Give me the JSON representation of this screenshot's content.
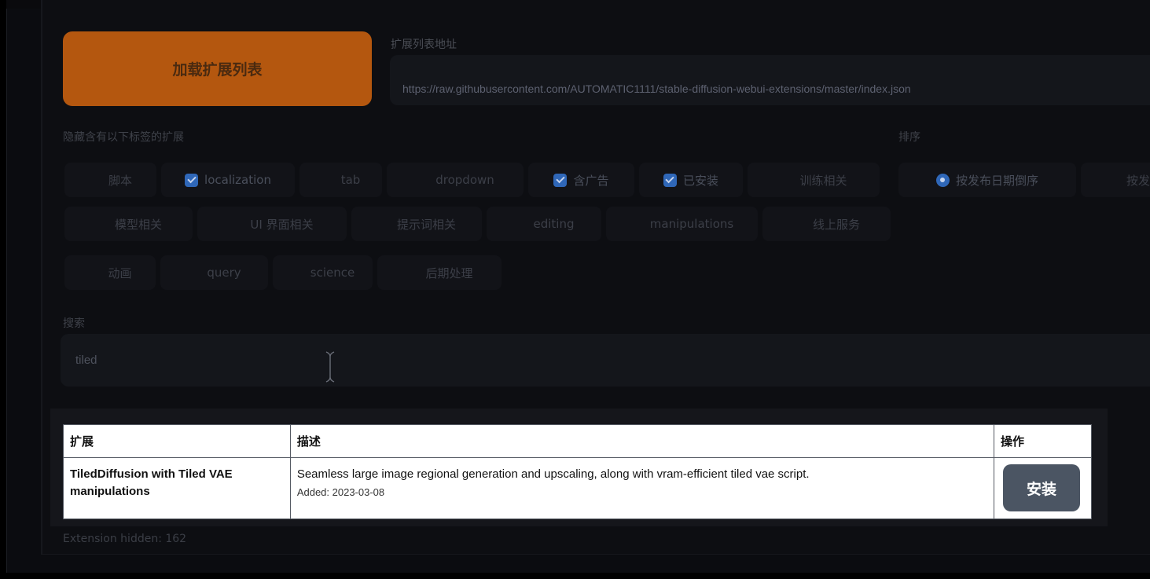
{
  "load_button": {
    "label": "加载扩展列表"
  },
  "url_field": {
    "label": "扩展列表地址",
    "value": "https://raw.githubusercontent.com/AUTOMATIC1111/stable-diffusion-webui-extensions/master/index.json"
  },
  "hide_tags": {
    "label": "隐藏含有以下标签的扩展",
    "rows": [
      [
        {
          "label": "脚本",
          "checked": false
        },
        {
          "label": "localization",
          "checked": true
        },
        {
          "label": "tab",
          "checked": false
        },
        {
          "label": "dropdown",
          "checked": false
        },
        {
          "label": "含广告",
          "checked": true
        },
        {
          "label": "已安装",
          "checked": true
        },
        {
          "label": "训练相关",
          "checked": false
        }
      ],
      [
        {
          "label": "模型相关",
          "checked": false
        },
        {
          "label": "UI 界面相关",
          "checked": false
        },
        {
          "label": "提示词相关",
          "checked": false
        },
        {
          "label": "editing",
          "checked": false
        },
        {
          "label": "manipulations",
          "checked": false
        },
        {
          "label": "线上服务",
          "checked": false
        }
      ],
      [
        {
          "label": "动画",
          "checked": false
        },
        {
          "label": "query",
          "checked": false
        },
        {
          "label": "science",
          "checked": false
        },
        {
          "label": "后期处理",
          "checked": false
        }
      ]
    ]
  },
  "sort": {
    "label": "排序",
    "options": [
      {
        "label": "按发布日期倒序",
        "selected": true
      },
      {
        "label": "按发",
        "selected": false
      }
    ]
  },
  "search": {
    "label": "搜索",
    "value": "tiled"
  },
  "table": {
    "headers": {
      "extension": "扩展",
      "description": "描述",
      "action": "操作"
    },
    "rows": [
      {
        "name": "TiledDiffusion with Tiled VAE manipulations",
        "description": "Seamless large image regional generation and upscaling, along with vram-efficient tiled vae script.",
        "added": "Added: 2023-03-08",
        "action": "安装"
      }
    ]
  },
  "hidden_count": "Extension hidden: 162",
  "colors": {
    "accent_orange": "#b4570f",
    "checkbox_blue": "#2f67b8",
    "install_button": "#4b5563"
  }
}
